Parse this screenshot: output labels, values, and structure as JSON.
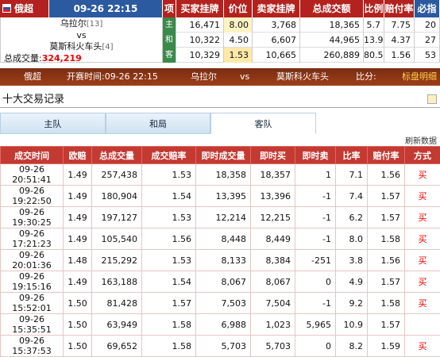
{
  "header": {
    "league": "俄超",
    "datetime": "09-26 22:15",
    "col_item": "项",
    "col_buy": "买家挂牌",
    "col_price": "价位",
    "col_sell": "卖家挂牌",
    "col_total": "总成交额",
    "col_ratio": "比例",
    "col_odds": "赔付率",
    "col_profit": "必指"
  },
  "match": {
    "home": "乌拉尔",
    "home_rank": "[13]",
    "vs": "vs",
    "away": "莫斯科火车头",
    "away_rank": "[4]",
    "total_label": "总成交量:",
    "total_value": "324,219"
  },
  "market_rows": [
    {
      "tag": "主",
      "buy": "16,471",
      "price": "8.00",
      "sell": "3,768",
      "total": "18,365",
      "ratio": "5.7",
      "odds": "7.75",
      "profit": "20"
    },
    {
      "tag": "和",
      "buy": "10,322",
      "price": "4.50",
      "sell": "6,607",
      "total": "44,965",
      "ratio": "13.9",
      "odds": "4.37",
      "profit": "27"
    },
    {
      "tag": "客",
      "buy": "10,329",
      "price": "1.53",
      "sell": "10,665",
      "total": "260,889",
      "ratio": "80.5",
      "odds": "1.56",
      "profit": "53"
    }
  ],
  "infobar": {
    "league": "俄超",
    "kickoff": "开赛时间:09-26 22:15",
    "home": "乌拉尔",
    "vs": "vs",
    "away": "莫斯科火车头",
    "ratio_label": "比分:",
    "link": "标盘明细"
  },
  "section": {
    "title": "十大交易记录"
  },
  "tabs": [
    {
      "label": "主队"
    },
    {
      "label": "和局"
    },
    {
      "label": "客队"
    }
  ],
  "refresh": "刷新数据",
  "table": {
    "headers": [
      "成交时间",
      "欧赔",
      "总成交量",
      "成交赔率",
      "即时成交量",
      "即时买",
      "即时卖",
      "比率",
      "赔付率",
      "方式"
    ],
    "rows": [
      [
        "09-26 20:51:41",
        "1.49",
        "257,438",
        "1.53",
        "18,358",
        "18,357",
        "1",
        "7.1",
        "1.56",
        "买"
      ],
      [
        "09-26 19:22:50",
        "1.49",
        "180,904",
        "1.54",
        "13,395",
        "13,396",
        "-1",
        "7.4",
        "1.57",
        "买"
      ],
      [
        "09-26 19:30:25",
        "1.49",
        "197,127",
        "1.53",
        "12,214",
        "12,215",
        "-1",
        "6.2",
        "1.57",
        "买"
      ],
      [
        "09-26 17:21:23",
        "1.49",
        "105,540",
        "1.56",
        "8,448",
        "8,449",
        "-1",
        "8.0",
        "1.58",
        "买"
      ],
      [
        "09-26 20:01:36",
        "1.48",
        "215,292",
        "1.53",
        "8,133",
        "8,384",
        "-251",
        "3.8",
        "1.56",
        "买"
      ],
      [
        "09-26 19:15:16",
        "1.49",
        "163,188",
        "1.54",
        "8,067",
        "8,067",
        "0",
        "4.9",
        "1.57",
        "买"
      ],
      [
        "09-26 15:52:01",
        "1.50",
        "81,428",
        "1.57",
        "7,503",
        "7,504",
        "-1",
        "9.2",
        "1.58",
        "买"
      ],
      [
        "09-26 15:35:51",
        "1.50",
        "63,949",
        "1.58",
        "6,988",
        "1,023",
        "5,965",
        "10.9",
        "1.57",
        ""
      ],
      [
        "09-26 15:37:53",
        "1.50",
        "69,652",
        "1.58",
        "5,703",
        "5,703",
        "0",
        "8.2",
        "1.59",
        "买"
      ]
    ]
  }
}
